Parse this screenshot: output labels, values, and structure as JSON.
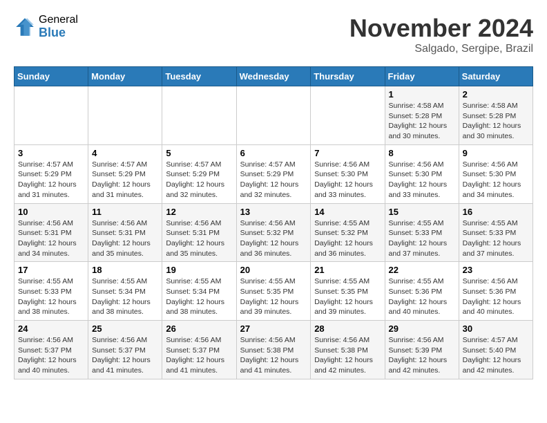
{
  "logo": {
    "general": "General",
    "blue": "Blue"
  },
  "title": "November 2024",
  "location": "Salgado, Sergipe, Brazil",
  "days_of_week": [
    "Sunday",
    "Monday",
    "Tuesday",
    "Wednesday",
    "Thursday",
    "Friday",
    "Saturday"
  ],
  "weeks": [
    [
      {
        "day": "",
        "info": ""
      },
      {
        "day": "",
        "info": ""
      },
      {
        "day": "",
        "info": ""
      },
      {
        "day": "",
        "info": ""
      },
      {
        "day": "",
        "info": ""
      },
      {
        "day": "1",
        "info": "Sunrise: 4:58 AM\nSunset: 5:28 PM\nDaylight: 12 hours and 30 minutes."
      },
      {
        "day": "2",
        "info": "Sunrise: 4:58 AM\nSunset: 5:28 PM\nDaylight: 12 hours and 30 minutes."
      }
    ],
    [
      {
        "day": "3",
        "info": "Sunrise: 4:57 AM\nSunset: 5:29 PM\nDaylight: 12 hours and 31 minutes."
      },
      {
        "day": "4",
        "info": "Sunrise: 4:57 AM\nSunset: 5:29 PM\nDaylight: 12 hours and 31 minutes."
      },
      {
        "day": "5",
        "info": "Sunrise: 4:57 AM\nSunset: 5:29 PM\nDaylight: 12 hours and 32 minutes."
      },
      {
        "day": "6",
        "info": "Sunrise: 4:57 AM\nSunset: 5:29 PM\nDaylight: 12 hours and 32 minutes."
      },
      {
        "day": "7",
        "info": "Sunrise: 4:56 AM\nSunset: 5:30 PM\nDaylight: 12 hours and 33 minutes."
      },
      {
        "day": "8",
        "info": "Sunrise: 4:56 AM\nSunset: 5:30 PM\nDaylight: 12 hours and 33 minutes."
      },
      {
        "day": "9",
        "info": "Sunrise: 4:56 AM\nSunset: 5:30 PM\nDaylight: 12 hours and 34 minutes."
      }
    ],
    [
      {
        "day": "10",
        "info": "Sunrise: 4:56 AM\nSunset: 5:31 PM\nDaylight: 12 hours and 34 minutes."
      },
      {
        "day": "11",
        "info": "Sunrise: 4:56 AM\nSunset: 5:31 PM\nDaylight: 12 hours and 35 minutes."
      },
      {
        "day": "12",
        "info": "Sunrise: 4:56 AM\nSunset: 5:31 PM\nDaylight: 12 hours and 35 minutes."
      },
      {
        "day": "13",
        "info": "Sunrise: 4:56 AM\nSunset: 5:32 PM\nDaylight: 12 hours and 36 minutes."
      },
      {
        "day": "14",
        "info": "Sunrise: 4:55 AM\nSunset: 5:32 PM\nDaylight: 12 hours and 36 minutes."
      },
      {
        "day": "15",
        "info": "Sunrise: 4:55 AM\nSunset: 5:33 PM\nDaylight: 12 hours and 37 minutes."
      },
      {
        "day": "16",
        "info": "Sunrise: 4:55 AM\nSunset: 5:33 PM\nDaylight: 12 hours and 37 minutes."
      }
    ],
    [
      {
        "day": "17",
        "info": "Sunrise: 4:55 AM\nSunset: 5:33 PM\nDaylight: 12 hours and 38 minutes."
      },
      {
        "day": "18",
        "info": "Sunrise: 4:55 AM\nSunset: 5:34 PM\nDaylight: 12 hours and 38 minutes."
      },
      {
        "day": "19",
        "info": "Sunrise: 4:55 AM\nSunset: 5:34 PM\nDaylight: 12 hours and 38 minutes."
      },
      {
        "day": "20",
        "info": "Sunrise: 4:55 AM\nSunset: 5:35 PM\nDaylight: 12 hours and 39 minutes."
      },
      {
        "day": "21",
        "info": "Sunrise: 4:55 AM\nSunset: 5:35 PM\nDaylight: 12 hours and 39 minutes."
      },
      {
        "day": "22",
        "info": "Sunrise: 4:55 AM\nSunset: 5:36 PM\nDaylight: 12 hours and 40 minutes."
      },
      {
        "day": "23",
        "info": "Sunrise: 4:56 AM\nSunset: 5:36 PM\nDaylight: 12 hours and 40 minutes."
      }
    ],
    [
      {
        "day": "24",
        "info": "Sunrise: 4:56 AM\nSunset: 5:37 PM\nDaylight: 12 hours and 40 minutes."
      },
      {
        "day": "25",
        "info": "Sunrise: 4:56 AM\nSunset: 5:37 PM\nDaylight: 12 hours and 41 minutes."
      },
      {
        "day": "26",
        "info": "Sunrise: 4:56 AM\nSunset: 5:37 PM\nDaylight: 12 hours and 41 minutes."
      },
      {
        "day": "27",
        "info": "Sunrise: 4:56 AM\nSunset: 5:38 PM\nDaylight: 12 hours and 41 minutes."
      },
      {
        "day": "28",
        "info": "Sunrise: 4:56 AM\nSunset: 5:38 PM\nDaylight: 12 hours and 42 minutes."
      },
      {
        "day": "29",
        "info": "Sunrise: 4:56 AM\nSunset: 5:39 PM\nDaylight: 12 hours and 42 minutes."
      },
      {
        "day": "30",
        "info": "Sunrise: 4:57 AM\nSunset: 5:40 PM\nDaylight: 12 hours and 42 minutes."
      }
    ]
  ]
}
